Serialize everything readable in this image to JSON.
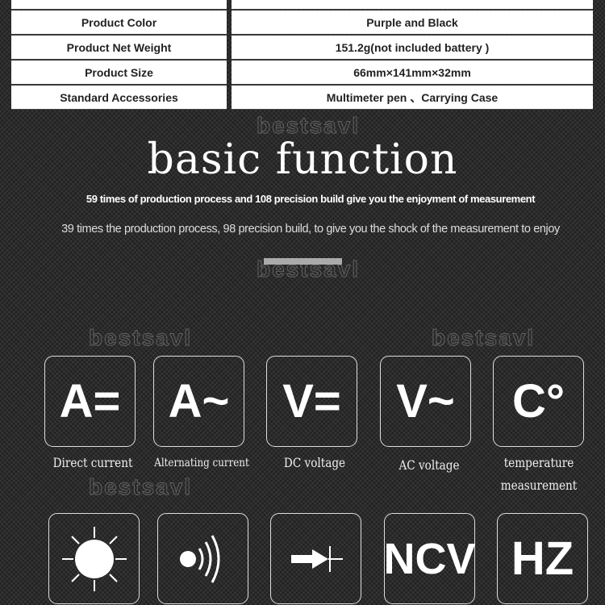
{
  "spec_table": [
    {
      "label": "",
      "value": ""
    },
    {
      "label": "Product Color",
      "value": "Purple and Black"
    },
    {
      "label": "Product Net Weight",
      "value": "151.2g(not included battery )"
    },
    {
      "label": "Product Size",
      "value": "66mm×141mm×32mm"
    },
    {
      "label": "Standard Accessories",
      "value": "Multimeter pen 、Carrying Case"
    }
  ],
  "heading": "basic function",
  "subtitle_bold": "59 times of  production process and 108 precision build give you the enjoyment of measurement",
  "subtitle": "39 times the production process, 98 precision build, to give you the shock of the measurement to enjoy",
  "watermark": "bestsavl",
  "functions": [
    {
      "symbol": "A=",
      "icon": "dc-current-icon",
      "label": "Direct current"
    },
    {
      "symbol": "A~",
      "icon": "ac-current-icon",
      "label": "Alternating current"
    },
    {
      "symbol": "V=",
      "icon": "dc-voltage-icon",
      "label": "DC voltage"
    },
    {
      "symbol": "V~",
      "icon": "ac-voltage-icon",
      "label": "AC voltage"
    },
    {
      "symbol": "C°",
      "icon": "temperature-icon",
      "label": "temperature measurement"
    },
    {
      "symbol": "",
      "icon": "backlight-sun-icon",
      "label": ""
    },
    {
      "symbol": "",
      "icon": "continuity-buzzer-icon",
      "label": ""
    },
    {
      "symbol": "",
      "icon": "diode-icon",
      "label": ""
    },
    {
      "symbol": "NCV",
      "icon": "ncv-icon",
      "label": ""
    },
    {
      "symbol": "HZ",
      "icon": "frequency-icon",
      "label": ""
    }
  ]
}
